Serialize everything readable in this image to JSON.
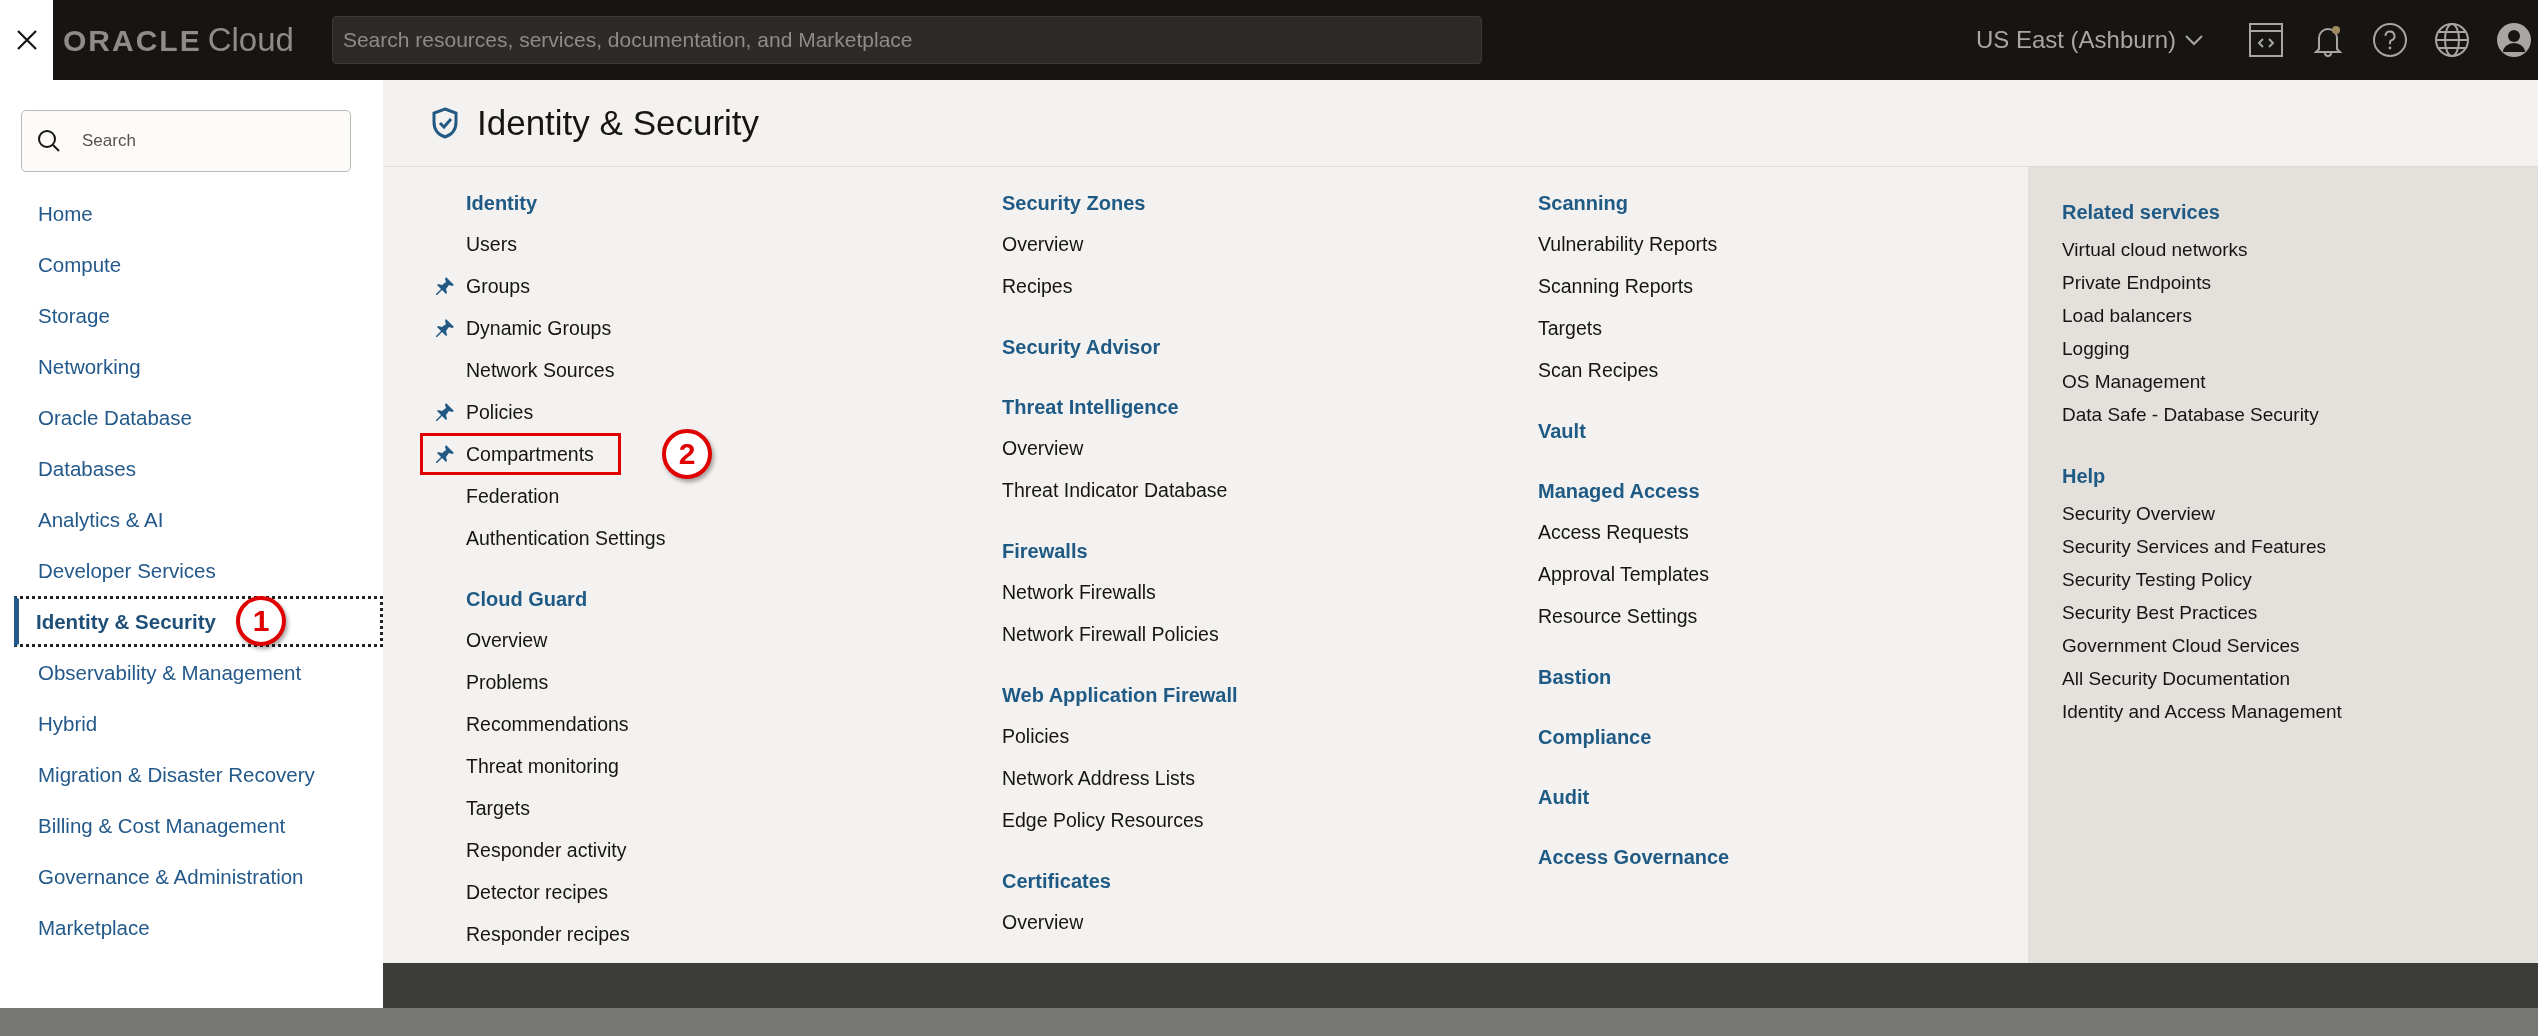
{
  "top_bar": {
    "logo": {
      "brand": "ORACLE",
      "product": "Cloud"
    },
    "search": {
      "placeholder": "Search resources, services, documentation, and Marketplace"
    },
    "region": "US East (Ashburn)",
    "notifications_unread": true
  },
  "sidebar": {
    "search": {
      "placeholder": "Search"
    },
    "items": [
      {
        "label": "Home",
        "selected": false
      },
      {
        "label": "Compute",
        "selected": false
      },
      {
        "label": "Storage",
        "selected": false
      },
      {
        "label": "Networking",
        "selected": false
      },
      {
        "label": "Oracle Database",
        "selected": false
      },
      {
        "label": "Databases",
        "selected": false
      },
      {
        "label": "Analytics & AI",
        "selected": false
      },
      {
        "label": "Developer Services",
        "selected": false
      },
      {
        "label": "Identity & Security",
        "selected": true,
        "callout": "1"
      },
      {
        "label": "Observability & Management",
        "selected": false
      },
      {
        "label": "Hybrid",
        "selected": false
      },
      {
        "label": "Migration & Disaster Recovery",
        "selected": false
      },
      {
        "label": "Billing & Cost Management",
        "selected": false
      },
      {
        "label": "Governance & Administration",
        "selected": false
      },
      {
        "label": "Marketplace",
        "selected": false
      }
    ]
  },
  "page": {
    "title": "Identity & Security"
  },
  "columns": [
    [
      {
        "heading": "Identity",
        "items": [
          {
            "label": "Users",
            "pinned": false,
            "highlighted": false
          },
          {
            "label": "Groups",
            "pinned": true,
            "highlighted": false
          },
          {
            "label": "Dynamic Groups",
            "pinned": true,
            "highlighted": false
          },
          {
            "label": "Network Sources",
            "pinned": false,
            "highlighted": false
          },
          {
            "label": "Policies",
            "pinned": true,
            "highlighted": false
          },
          {
            "label": "Compartments",
            "pinned": true,
            "highlighted": true,
            "callout": "2"
          },
          {
            "label": "Federation",
            "pinned": false,
            "highlighted": false
          },
          {
            "label": "Authentication Settings",
            "pinned": false,
            "highlighted": false
          }
        ]
      },
      {
        "heading": "Cloud Guard",
        "items": [
          {
            "label": "Overview",
            "pinned": false,
            "highlighted": false
          },
          {
            "label": "Problems",
            "pinned": false,
            "highlighted": false
          },
          {
            "label": "Recommendations",
            "pinned": false,
            "highlighted": false
          },
          {
            "label": "Threat monitoring",
            "pinned": false,
            "highlighted": false
          },
          {
            "label": "Targets",
            "pinned": false,
            "highlighted": false
          },
          {
            "label": "Responder activity",
            "pinned": false,
            "highlighted": false
          },
          {
            "label": "Detector recipes",
            "pinned": false,
            "highlighted": false
          },
          {
            "label": "Responder recipes",
            "pinned": false,
            "highlighted": false
          }
        ]
      }
    ],
    [
      {
        "heading": "Security Zones",
        "items": [
          {
            "label": "Overview",
            "pinned": false,
            "highlighted": false
          },
          {
            "label": "Recipes",
            "pinned": false,
            "highlighted": false
          }
        ]
      },
      {
        "heading": "Security Advisor"
      },
      {
        "heading": "Threat Intelligence",
        "items": [
          {
            "label": "Overview",
            "pinned": false,
            "highlighted": false
          },
          {
            "label": "Threat Indicator Database",
            "pinned": false,
            "highlighted": false
          }
        ]
      },
      {
        "heading": "Firewalls",
        "items": [
          {
            "label": "Network Firewalls",
            "pinned": false,
            "highlighted": false
          },
          {
            "label": "Network Firewall Policies",
            "pinned": false,
            "highlighted": false
          }
        ]
      },
      {
        "heading": "Web Application Firewall",
        "items": [
          {
            "label": "Policies",
            "pinned": false,
            "highlighted": false
          },
          {
            "label": "Network Address Lists",
            "pinned": false,
            "highlighted": false
          },
          {
            "label": "Edge Policy Resources",
            "pinned": false,
            "highlighted": false
          }
        ]
      },
      {
        "heading": "Certificates",
        "items": [
          {
            "label": "Overview",
            "pinned": false,
            "highlighted": false
          }
        ]
      }
    ],
    [
      {
        "heading": "Scanning",
        "items": [
          {
            "label": "Vulnerability Reports",
            "pinned": false,
            "highlighted": false
          },
          {
            "label": "Scanning Reports",
            "pinned": false,
            "highlighted": false
          },
          {
            "label": "Targets",
            "pinned": false,
            "highlighted": false
          },
          {
            "label": "Scan Recipes",
            "pinned": false,
            "highlighted": false
          }
        ]
      },
      {
        "heading": "Vault"
      },
      {
        "heading": "Managed Access",
        "items": [
          {
            "label": "Access Requests",
            "pinned": false,
            "highlighted": false
          },
          {
            "label": "Approval Templates",
            "pinned": false,
            "highlighted": false
          },
          {
            "label": "Resource Settings",
            "pinned": false,
            "highlighted": false
          }
        ]
      },
      {
        "heading": "Bastion"
      },
      {
        "heading": "Compliance"
      },
      {
        "heading": "Audit"
      },
      {
        "heading": "Access Governance"
      }
    ]
  ],
  "related": [
    {
      "heading": "Related services",
      "items": [
        "Virtual cloud networks",
        "Private Endpoints",
        "Load balancers",
        "Logging",
        "OS Management",
        "Data Safe - Database Security"
      ]
    },
    {
      "heading": "Help",
      "items": [
        "Security Overview",
        "Security Services and Features",
        "Security Testing Policy",
        "Security Best Practices",
        "Government Cloud Services",
        "All Security Documentation",
        "Identity and Access Management"
      ]
    }
  ]
}
